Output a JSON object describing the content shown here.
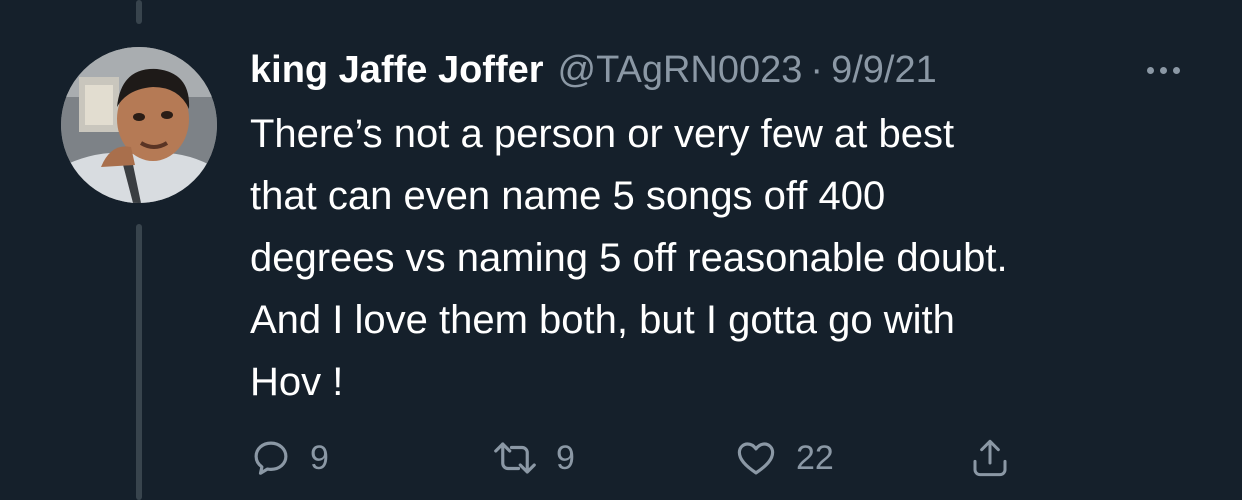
{
  "tweet": {
    "author_name": "king Jaffe Joffer",
    "handle": "@TAgRN0023",
    "separator": "·",
    "date": "9/9/21",
    "text": "There’s not a person or very few at best\nthat can even name 5 songs off 400\ndegrees vs naming 5 off reasonable doubt.\nAnd I love them both, but I gotta go with\nHov !"
  },
  "actions": {
    "reply_count": "9",
    "retweet_count": "9",
    "like_count": "22"
  },
  "icons": {
    "reply": "reply-icon",
    "retweet": "retweet-icon",
    "like": "heart-icon",
    "share": "share-icon",
    "more": "more-icon"
  },
  "colors": {
    "background": "#15202b",
    "primary_text": "#ffffff",
    "secondary_text": "#8b98a5",
    "thread_line": "#38444d"
  }
}
